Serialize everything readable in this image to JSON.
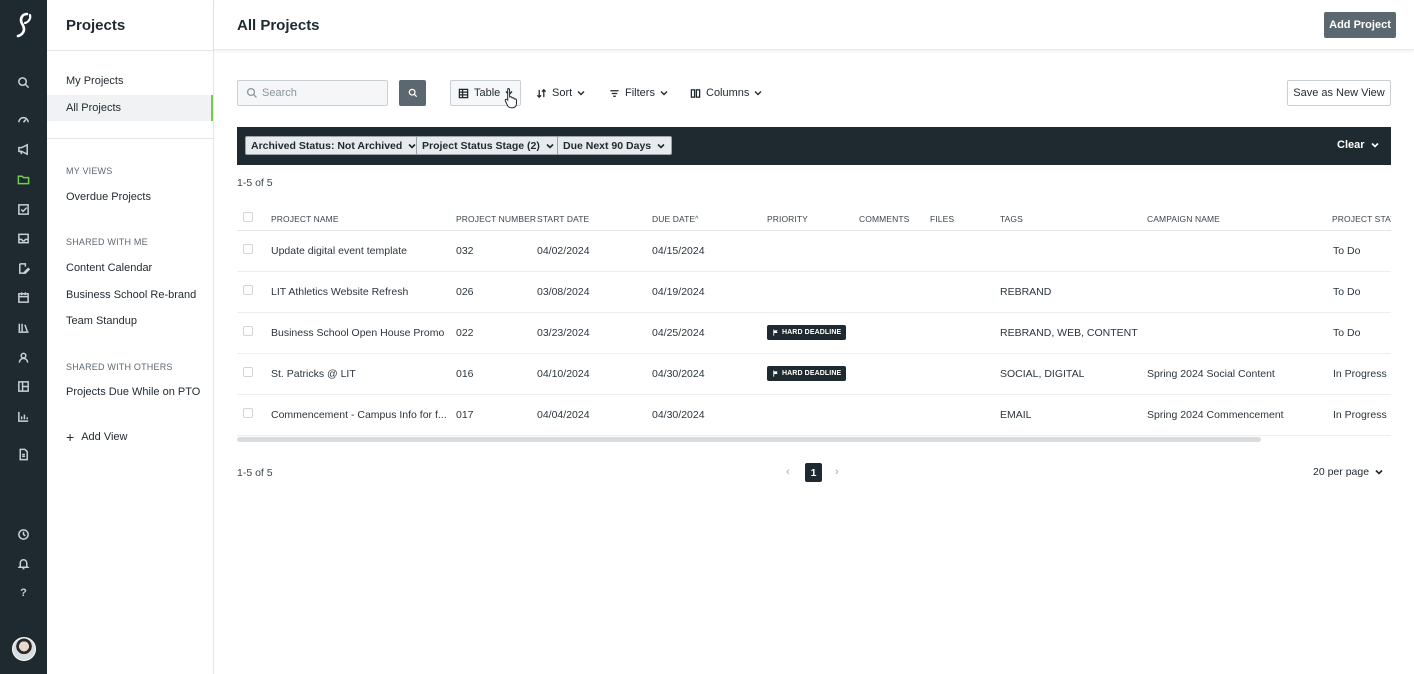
{
  "sidebar": {
    "title": "Projects",
    "items": [
      {
        "label": "My Projects"
      },
      {
        "label": "All Projects"
      }
    ],
    "my_views_heading": "MY VIEWS",
    "my_views": [
      {
        "label": "Overdue Projects"
      }
    ],
    "shared_with_me_heading": "SHARED WITH ME",
    "shared_with_me": [
      {
        "label": "Content Calendar"
      },
      {
        "label": "Business School Re-brand"
      },
      {
        "label": "Team Standup"
      }
    ],
    "shared_with_others_heading": "SHARED WITH OTHERS",
    "shared_with_others": [
      {
        "label": "Projects Due While on PTO"
      }
    ],
    "add_view_label": "Add View"
  },
  "rail": {
    "icons": [
      "logo-icon",
      "search-icon",
      "dashboard-icon",
      "megaphone-icon",
      "folder-icon",
      "task-check-icon",
      "inbox-icon",
      "edit-document-icon",
      "calendar-icon",
      "library-icon",
      "user-icon",
      "layout-icon",
      "chart-icon",
      "document-icon",
      "clock-icon",
      "bell-icon",
      "help-icon"
    ],
    "active": "folder-icon",
    "help_glyph": "?"
  },
  "header": {
    "title": "All Projects",
    "add_button": "Add Project"
  },
  "toolbar": {
    "search_placeholder": "Search",
    "view_label": "Table",
    "sort_label": "Sort",
    "filters_label": "Filters",
    "columns_label": "Columns",
    "save_view_label": "Save as New View"
  },
  "filters": {
    "chips": [
      {
        "label": "Archived Status: Not Archived"
      },
      {
        "label": "Project Status Stage (2)"
      },
      {
        "label": "Due Next 90 Days"
      }
    ],
    "clear_label": "Clear"
  },
  "count_top": "1-5 of 5",
  "count_bottom": "1-5 of 5",
  "table": {
    "columns": [
      "PROJECT NAME",
      "PROJECT NUMBER",
      "START DATE",
      "DUE DATE",
      "PRIORITY",
      "COMMENTS",
      "FILES",
      "TAGS",
      "CAMPAIGN NAME",
      "PROJECT STATUS"
    ],
    "sorted_column": "DUE DATE",
    "sort_glyph": "^",
    "rows": [
      {
        "name": "Update digital event template",
        "number": "032",
        "start": "04/02/2024",
        "due": "04/15/2024",
        "priority": "",
        "tags": "",
        "campaign": "",
        "status": "To Do"
      },
      {
        "name": "LIT Athletics Website Refresh",
        "number": "026",
        "start": "03/08/2024",
        "due": "04/19/2024",
        "priority": "",
        "tags": "REBRAND",
        "campaign": "",
        "status": "To Do"
      },
      {
        "name": "Business School Open House Promo",
        "number": "022",
        "start": "03/23/2024",
        "due": "04/25/2024",
        "priority": "HARD DEADLINE",
        "tags": "REBRAND, WEB, CONTENT C...",
        "campaign": "",
        "status": "To Do"
      },
      {
        "name": "St. Patricks @ LIT",
        "number": "016",
        "start": "04/10/2024",
        "due": "04/30/2024",
        "priority": "HARD DEADLINE",
        "tags": "SOCIAL, DIGITAL",
        "campaign": "Spring 2024 Social Content",
        "status": "In Progress"
      },
      {
        "name": "Commencement - Campus Info for f...",
        "number": "017",
        "start": "04/04/2024",
        "due": "04/30/2024",
        "priority": "",
        "tags": "EMAIL",
        "campaign": "Spring 2024 Commencement",
        "status": "In Progress"
      }
    ]
  },
  "pagination": {
    "prev": "‹",
    "current": "1",
    "next": "›",
    "per_page": "20 per page"
  },
  "colors": {
    "rail_bg": "#1f2a30",
    "accent": "#6fcf4a",
    "primary_button": "#5c6870"
  }
}
